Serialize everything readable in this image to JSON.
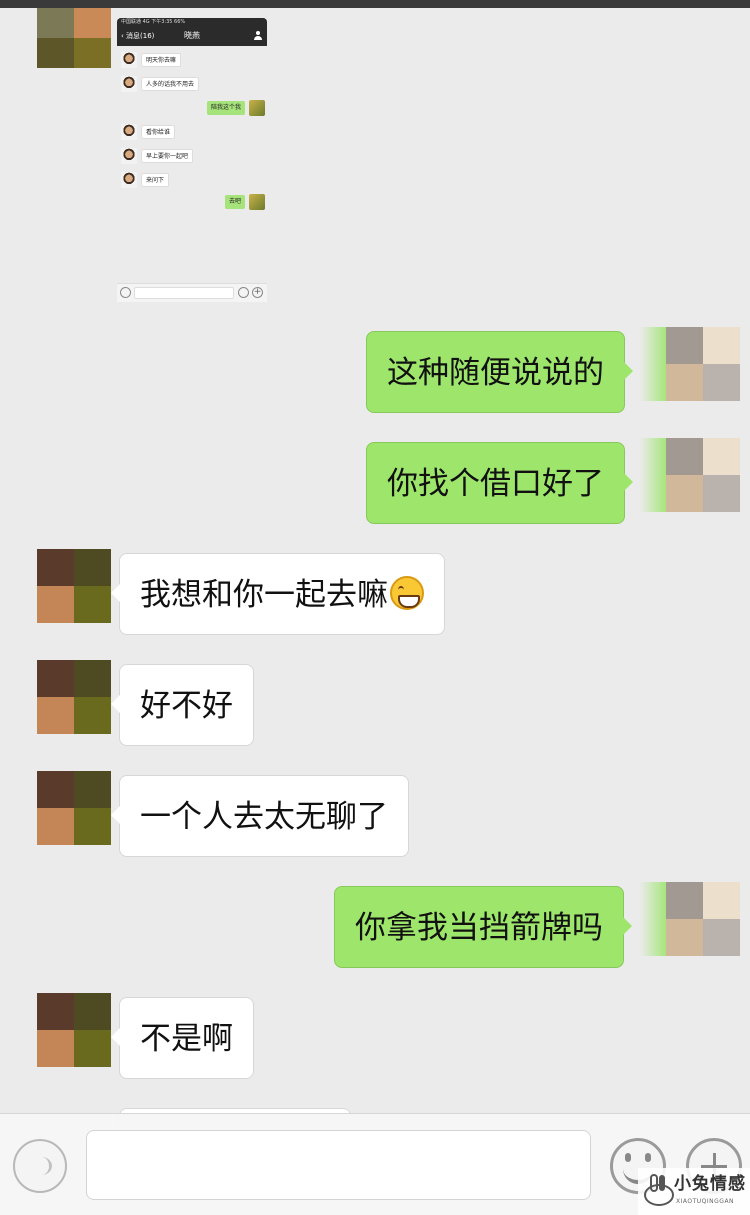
{
  "thumbnail": {
    "status_text": "中国联通 4G 下午3:35 66%",
    "back_label": "消息(16)",
    "title": "晓燕",
    "messages": [
      {
        "side": "left",
        "text": "明天你去嘛"
      },
      {
        "side": "left",
        "text": "人多的话我不用去"
      },
      {
        "side": "right",
        "text": "陪我这个我"
      },
      {
        "side": "left",
        "text": "看你给谁"
      },
      {
        "side": "left",
        "text": "早上要你一起吧"
      },
      {
        "side": "left",
        "text": "来问下"
      },
      {
        "side": "right",
        "text": "去吧"
      }
    ]
  },
  "conversation": [
    {
      "side": "right",
      "text": "这种随便说说的"
    },
    {
      "side": "right",
      "text": "你找个借口好了"
    },
    {
      "side": "left",
      "text": "我想和你一起去嘛",
      "emoji": "grinning-face-emoji"
    },
    {
      "side": "left",
      "text": "好不好"
    },
    {
      "side": "left",
      "text": "一个人去太无聊了"
    },
    {
      "side": "right",
      "text": "你拿我当挡箭牌吗"
    },
    {
      "side": "left",
      "text": "不是啊"
    }
  ],
  "input_bar": {
    "message_value": "",
    "icons": [
      "voice-icon",
      "emoji-icon",
      "plus-icon"
    ]
  },
  "watermark": {
    "main": "小兔情感",
    "sub": "XIAOTUQINGGAN"
  },
  "colors": {
    "background": "#ebebeb",
    "outgoing_bubble": "#9ee66b",
    "incoming_bubble": "#ffffff"
  }
}
